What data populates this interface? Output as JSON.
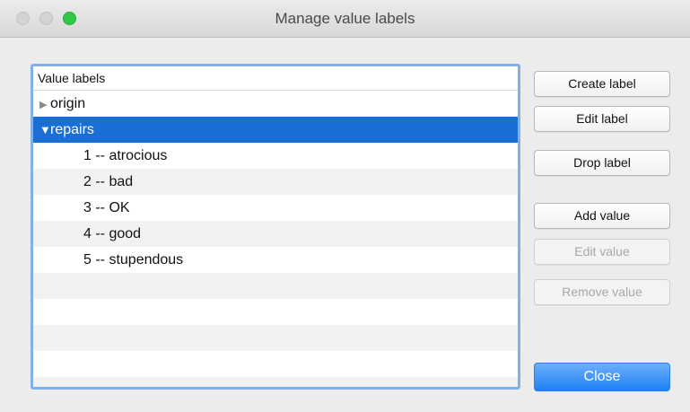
{
  "window": {
    "title": "Manage value labels"
  },
  "panel": {
    "header": "Value labels",
    "rows": [
      {
        "label": "origin",
        "expanded": false,
        "selected": false,
        "arrow": "▶"
      },
      {
        "label": "repairs",
        "expanded": true,
        "selected": true,
        "arrow": "▼"
      },
      {
        "label": "1 -- atrocious"
      },
      {
        "label": "2 -- bad"
      },
      {
        "label": "3 -- OK"
      },
      {
        "label": "4 -- good"
      },
      {
        "label": "5 -- stupendous"
      }
    ]
  },
  "buttons": {
    "create_label": "Create label",
    "edit_label": "Edit label",
    "drop_label": "Drop label",
    "add_value": "Add value",
    "edit_value": "Edit value",
    "remove_value": "Remove value",
    "close": "Close"
  },
  "colors": {
    "selection": "#1a6fd6",
    "focus_ring": "#7fb0ea",
    "default_button": "#1e80f5",
    "zoom_light": "#33c748"
  }
}
